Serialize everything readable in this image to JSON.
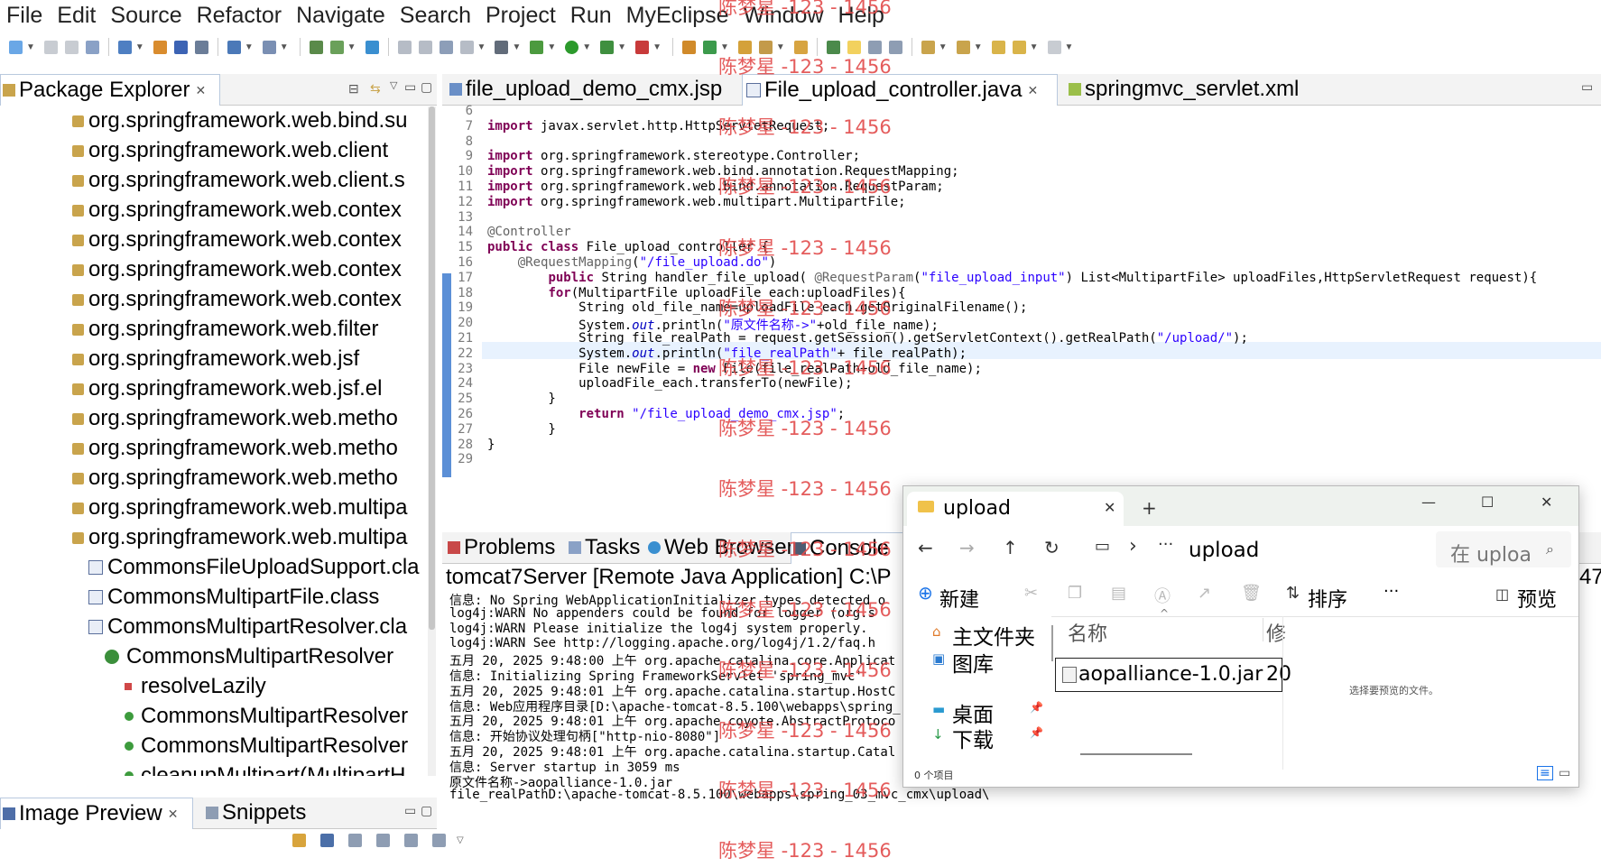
{
  "menu": [
    "File",
    "Edit",
    "Source",
    "Refactor",
    "Navigate",
    "Search",
    "Project",
    "Run",
    "MyEclipse",
    "Window",
    "Help"
  ],
  "package_explorer": {
    "title": "Package Explorer",
    "items": [
      {
        "label": "org.springframework.web.bind.su",
        "type": "package"
      },
      {
        "label": "org.springframework.web.client",
        "type": "package"
      },
      {
        "label": "org.springframework.web.client.s",
        "type": "package"
      },
      {
        "label": "org.springframework.web.contex",
        "type": "package"
      },
      {
        "label": "org.springframework.web.contex",
        "type": "package"
      },
      {
        "label": "org.springframework.web.contex",
        "type": "package"
      },
      {
        "label": "org.springframework.web.contex",
        "type": "package"
      },
      {
        "label": "org.springframework.web.filter",
        "type": "package"
      },
      {
        "label": "org.springframework.web.jsf",
        "type": "package"
      },
      {
        "label": "org.springframework.web.jsf.el",
        "type": "package"
      },
      {
        "label": "org.springframework.web.metho",
        "type": "package"
      },
      {
        "label": "org.springframework.web.metho",
        "type": "package"
      },
      {
        "label": "org.springframework.web.metho",
        "type": "package"
      },
      {
        "label": "org.springframework.web.multipa",
        "type": "package"
      },
      {
        "label": "org.springframework.web.multipa",
        "type": "package"
      },
      {
        "label": "CommonsFileUploadSupport.cla",
        "type": "classfile"
      },
      {
        "label": "CommonsMultipartFile.class",
        "type": "classfile"
      },
      {
        "label": "CommonsMultipartResolver.cla",
        "type": "classfile"
      },
      {
        "label": "CommonsMultipartResolver",
        "type": "class"
      },
      {
        "label": "resolveLazily",
        "type": "field"
      },
      {
        "label": "CommonsMultipartResolver",
        "type": "constructor"
      },
      {
        "label": "CommonsMultipartResolver",
        "type": "constructor"
      },
      {
        "label": "cleanupMultipart(MultipartH",
        "type": "method"
      }
    ]
  },
  "bottom_left_tabs": {
    "image_preview": "Image Preview",
    "snippets": "Snippets"
  },
  "editor_tabs": [
    "file_upload_demo_cmx.jsp",
    "File_upload_controller.java",
    "springmvc_servlet.xml"
  ],
  "code": [
    {
      "n": "6",
      "t": ""
    },
    {
      "n": "7",
      "t": "import javax.servlet.http.HttpServletRequest;"
    },
    {
      "n": "8",
      "t": ""
    },
    {
      "n": "9",
      "t": "import org.springframework.stereotype.Controller;"
    },
    {
      "n": "10",
      "t": "import org.springframework.web.bind.annotation.RequestMapping;"
    },
    {
      "n": "11",
      "t": "import org.springframework.web.bind.annotation.RequestParam;"
    },
    {
      "n": "12",
      "t": "import org.springframework.web.multipart.MultipartFile;"
    },
    {
      "n": "13",
      "t": ""
    },
    {
      "n": "14",
      "t": "@Controller"
    },
    {
      "n": "15",
      "t": "public class File_upload_controller {"
    },
    {
      "n": "16",
      "t": "    @RequestMapping(\"/file_upload.do\")"
    },
    {
      "n": "17",
      "t": "        public String handler_file_upload( @RequestParam(\"file_upload_input\") List<MultipartFile> uploadFiles,HttpServletRequest request){"
    },
    {
      "n": "18",
      "t": "        for(MultipartFile uploadFile_each:uploadFiles){"
    },
    {
      "n": "19",
      "t": "            String old_file_name=uploadFile_each.getOriginalFilename();"
    },
    {
      "n": "20",
      "t": "            System.out.println(\"原文件名称->\"+old_file_name);"
    },
    {
      "n": "21",
      "t": "            String file_realPath = request.getSession().getServletContext().getRealPath(\"/upload/\");"
    },
    {
      "n": "22",
      "t": "            System.out.println(\"file_realPath\"+ file_realPath);"
    },
    {
      "n": "23",
      "t": "            File newFile = new File(file_realPath+old_file_name);"
    },
    {
      "n": "24",
      "t": "            uploadFile_each.transferTo(newFile);"
    },
    {
      "n": "25",
      "t": "        }"
    },
    {
      "n": "26",
      "t": "            return \"/file_upload_demo_cmx.jsp\";"
    },
    {
      "n": "27",
      "t": "        }"
    },
    {
      "n": "28",
      "t": "}"
    },
    {
      "n": "29",
      "t": ""
    }
  ],
  "console": {
    "tabs": [
      "Problems",
      "Tasks",
      "Web Browser",
      "Console"
    ],
    "header": "tomcat7Server [Remote Java Application] C:\\P",
    "header_tail": "47",
    "lines": [
      "信息: No Spring WebApplicationInitializer types detected o",
      "log4j:WARN No appenders could be found for logger (org.s",
      "log4j:WARN Please initialize the log4j system properly.",
      "log4j:WARN See http://logging.apache.org/log4j/1.2/faq.h",
      "五月 20, 2025 9:48:00 上午 org.apache.catalina.core.Applicat",
      "信息: Initializing Spring FrameworkServlet 'spring_mvc'",
      "五月 20, 2025 9:48:01 上午 org.apache.catalina.startup.HostC",
      "信息: Web应用程序目录[D:\\apache-tomcat-8.5.100\\webapps\\spring_",
      "五月 20, 2025 9:48:01 上午 org.apache.coyote.AbstractProtoco",
      "信息: 开始协议处理句柄[\"http-nio-8080\"]",
      "五月 20, 2025 9:48:01 上午 org.apache.catalina.startup.Catal",
      "信息: Server startup in 3059 ms",
      "原文件名称->aopalliance-1.0.jar",
      "file_realPathD:\\apache-tomcat-8.5.100\\webapps\\spring_03_mvc_cmx\\upload\\"
    ]
  },
  "explorer": {
    "tab_title": "upload",
    "address": "upload",
    "search_placeholder": "在 uploa",
    "new_label": "新建",
    "sort_label": "排序",
    "more": "···",
    "preview_label": "预览",
    "nav_items": [
      "主文件夹",
      "图库",
      "桌面",
      "下载"
    ],
    "col_name": "名称",
    "col_modified": "修",
    "file_name": "aopalliance-1.0.jar",
    "file_date": "20",
    "preview_hint": "选择要预览的文件。",
    "status": "0 个项目"
  },
  "watermark": "陈梦星 -123 - 1456",
  "colors": {
    "keyword": "#7f0055",
    "string": "#2a00ff",
    "annotation": "#646464",
    "watermark": "#e24b4b",
    "selection": "#1a73e8"
  }
}
